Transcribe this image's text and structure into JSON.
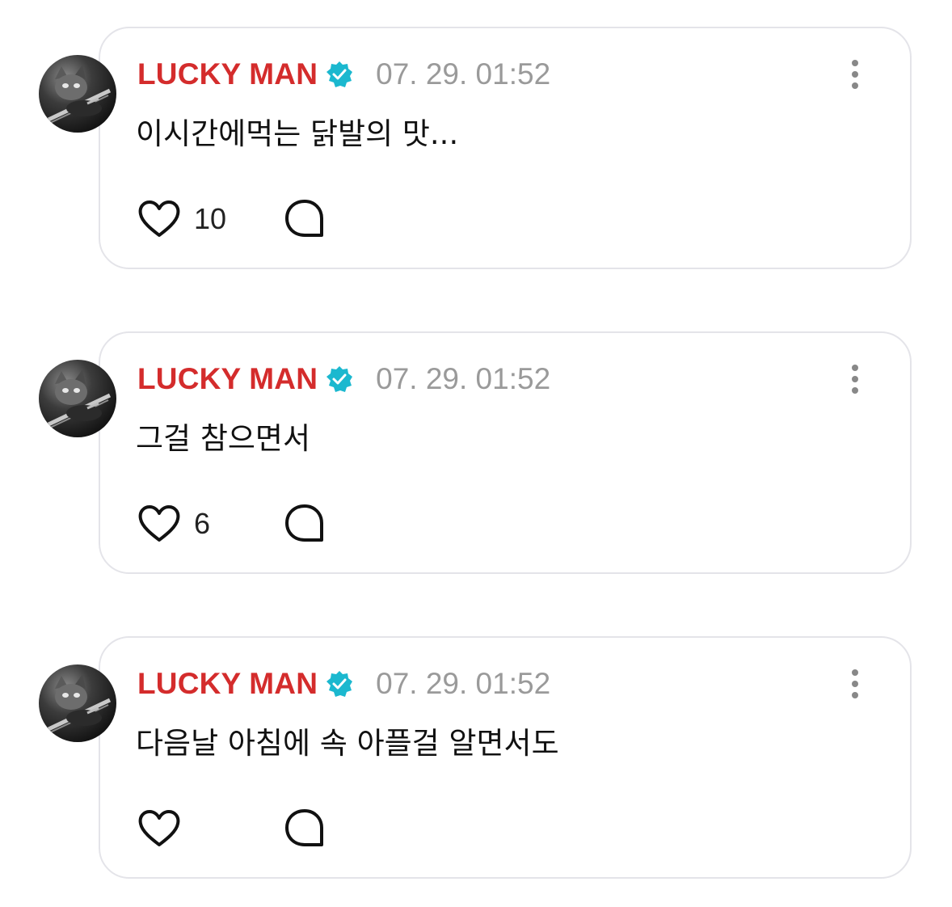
{
  "posts": [
    {
      "username": "LUCKY MAN",
      "timestamp": "07. 29. 01:52",
      "text": "이시간에먹는 닭발의 맛...",
      "likes": "10"
    },
    {
      "username": "LUCKY MAN",
      "timestamp": "07. 29. 01:52",
      "text": "그걸 참으면서",
      "likes": "6"
    },
    {
      "username": "LUCKY MAN",
      "timestamp": "07. 29. 01:52",
      "text": "다음날 아침에 속 아플걸 알면서도",
      "likes": ""
    }
  ],
  "colors": {
    "username": "#d42c2c",
    "verified_badge": "#1bb8cf",
    "timestamp": "#9a9a9a",
    "card_border": "#e4e4e9"
  },
  "icons": {
    "verified": "verified-badge-icon",
    "more": "more-vertical-icon",
    "like": "heart-icon",
    "comment": "comment-bubble-icon"
  }
}
